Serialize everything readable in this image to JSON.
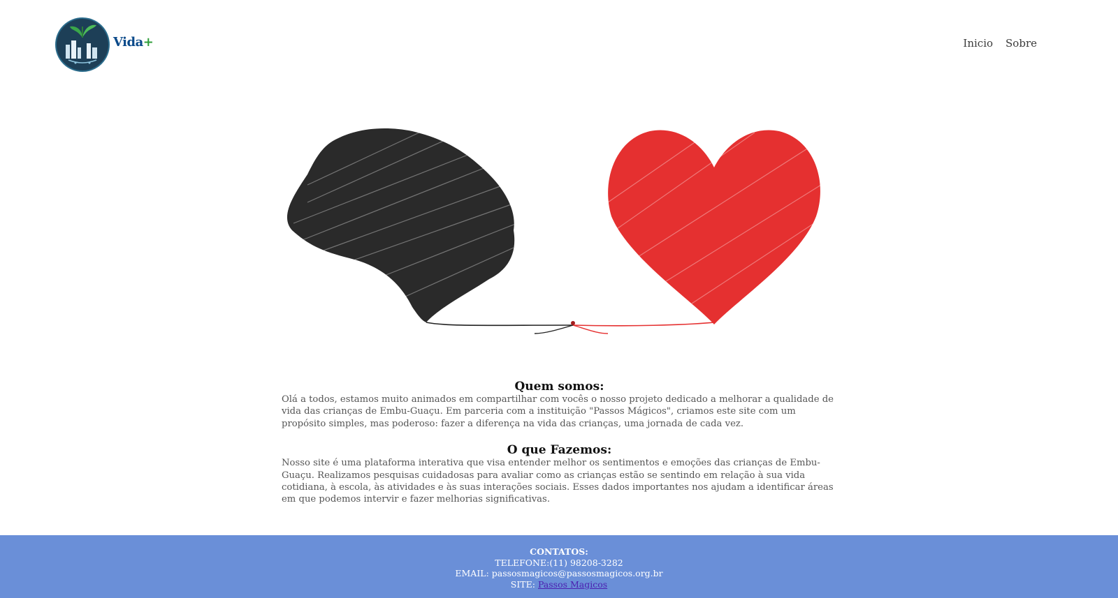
{
  "brand": {
    "name": "Vida",
    "plus": "+"
  },
  "nav": {
    "items": [
      {
        "label": "Inicio"
      },
      {
        "label": "Sobre"
      }
    ]
  },
  "hero": {
    "icons": [
      "brain-scribble-icon",
      "heart-scribble-icon"
    ],
    "colors": {
      "brain": "#222222",
      "heart": "#e53030"
    }
  },
  "sections": [
    {
      "title": "Quem somos:",
      "text": "Olá a todos, estamos muito animados em compartilhar com vocês o nosso projeto dedicado a melhorar a qualidade de vida das crianças de Embu-Guaçu. Em parceria com a instituição \"Passos Mágicos\", criamos este site com um propósito simples, mas poderoso: fazer a diferença na vida das crianças, uma jornada de cada vez."
    },
    {
      "title": "O que Fazemos:",
      "text": "Nosso site é uma plataforma interativa que visa entender melhor os sentimentos e emoções das crianças de Embu-Guaçu. Realizamos pesquisas cuidadosas para avaliar como as crianças estão se sentindo em relação à sua vida cotidiana, à escola, às atividades e às suas interações sociais. Esses dados importantes nos ajudam a identificar áreas em que podemos intervir e fazer melhorias significativas."
    }
  ],
  "footer": {
    "title": "CONTATOS:",
    "phone": "TELEFONE:(11) 98208-3282",
    "email": "EMAIL: passosmagicos@passosmagicos.org.br",
    "site_label": "SITE: ",
    "site_link": "Passos Magicos",
    "background": "#6a8fd8"
  }
}
